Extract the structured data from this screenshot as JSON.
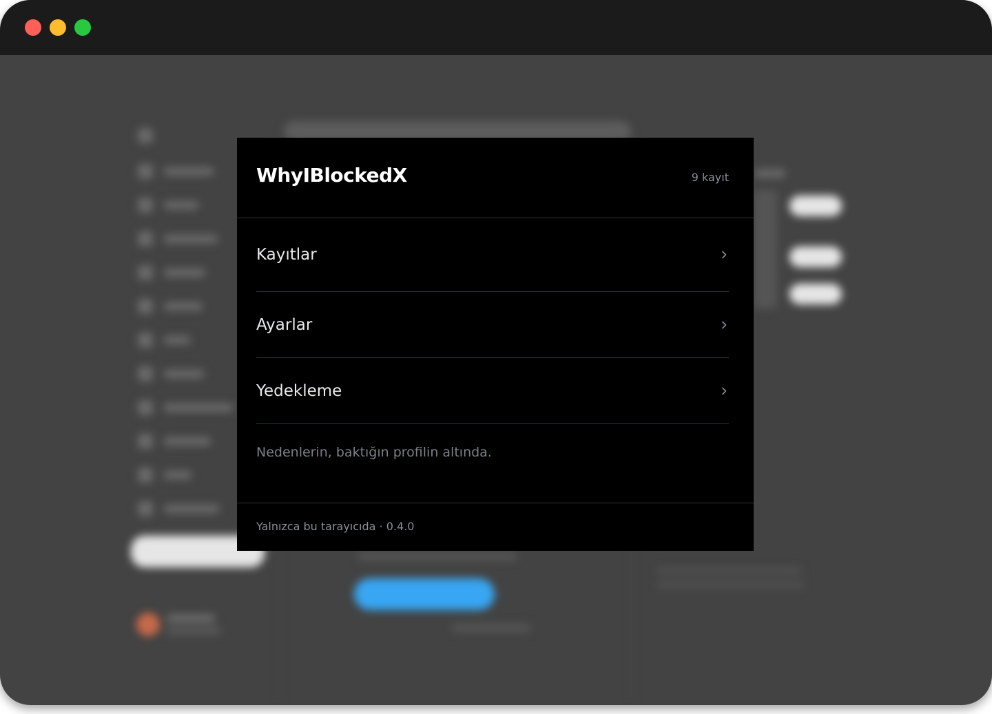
{
  "window": {
    "traffic_lights": [
      "close",
      "minimize",
      "maximize"
    ]
  },
  "popup": {
    "title": "WhyIBlockedX",
    "record_count": "9 kayıt",
    "menu": [
      {
        "label": "Kayıtlar",
        "icon": "chevron-right-icon"
      },
      {
        "label": "Ayarlar",
        "icon": "chevron-right-icon"
      },
      {
        "label": "Yedekleme",
        "icon": "chevron-right-icon"
      }
    ],
    "hint": "Nedenlerin, baktığın profilin altında.",
    "footer": "Yalnızca bu tarayıcıda · 0.4.0"
  },
  "colors": {
    "popup_bg": "#000000",
    "window_bg": "#434343",
    "titlebar_bg": "#1b1b1b",
    "divider": "#2f3336",
    "muted_text": "#8b9096",
    "accent_blue": "#38a6f2"
  }
}
